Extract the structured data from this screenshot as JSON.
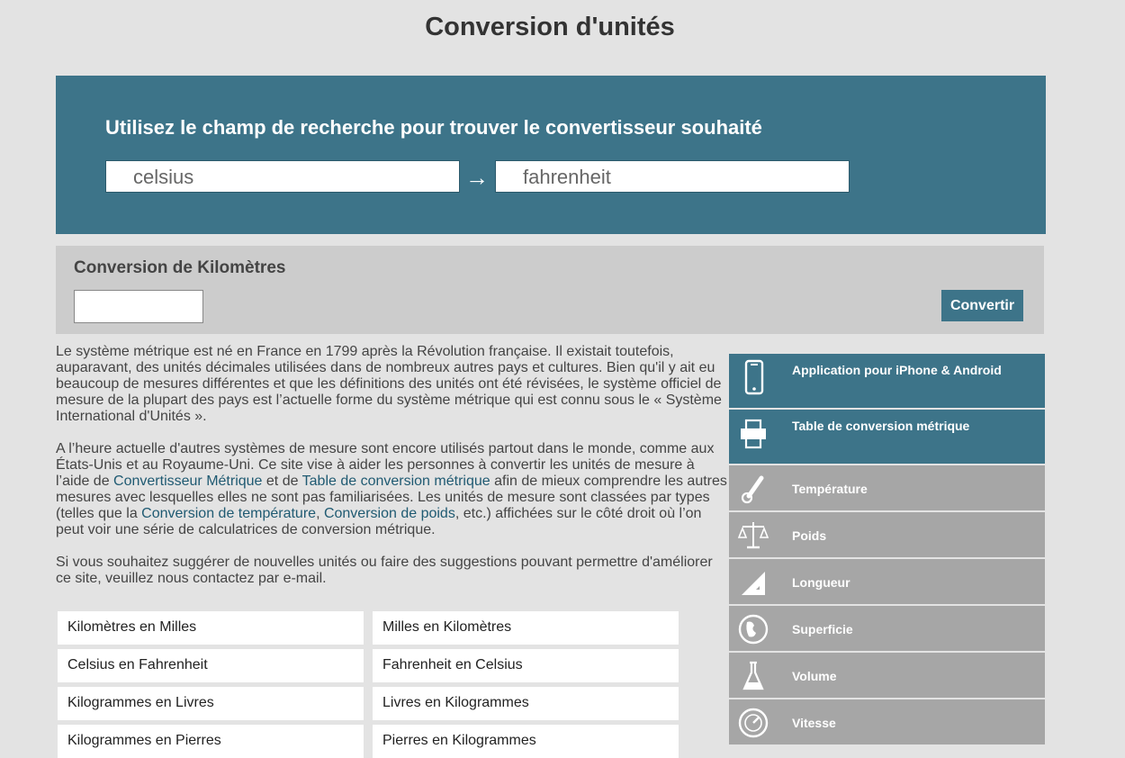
{
  "page": {
    "title": "Conversion d'unités"
  },
  "search": {
    "heading": "Utilisez le champ de recherche pour trouver le convertisseur souhaité",
    "from_value": "celsius",
    "to_value": "fahrenheit",
    "arrow": "→"
  },
  "converter": {
    "title": "Conversion de Kilomètres",
    "input_value": "",
    "button_label": "Convertir"
  },
  "content": {
    "p1": "Le système métrique est né en France en 1799 après la Révolution française. Il existait toutefois, auparavant, des unités décimales utilisées dans de nombreux autres pays et cultures. Bien qu'il y ait eu beaucoup de mesures différentes et que les définitions des unités ont été révisées, le système officiel de mesure de la plupart des pays est l’actuelle forme du système métrique qui est connu sous le « Système International d'Unités ».",
    "p2_a": "A l’heure actuelle d'autres systèmes de mesure sont encore utilisés partout dans le monde, comme aux États-Unis et au Royaume-Uni. Ce site vise à aider les personnes à convertir les unités de mesure à l’aide de ",
    "p2_link1": "Convertisseur Métrique",
    "p2_b": " et de ",
    "p2_link2": "Table de conversion métrique",
    "p2_c": " afin de mieux comprendre les autres mesures avec lesquelles elles ne sont pas familiarisées. Les unités de mesure sont classées par types (telles que la ",
    "p2_link3": "Conversion de température",
    "p2_d": ", ",
    "p2_link4": "Conversion de poids",
    "p2_e": ", etc.) affichées sur le côté droit où l’on peut voir une série de calculatrices de conversion métrique.",
    "p3": "Si vous souhaitez suggérer de nouvelles unités ou faire des suggestions pouvant permettre d'améliorer ce site, veuillez nous contactez par e-mail."
  },
  "links": [
    "Kilomètres en Milles",
    "Milles en Kilomètres",
    "Celsius en Fahrenheit",
    "Fahrenheit en Celsius",
    "Kilogrammes en Livres",
    "Livres en Kilogrammes",
    "Kilogrammes en Pierres",
    "Pierres en Kilogrammes"
  ],
  "sidebar": {
    "items": [
      {
        "label": "Application pour iPhone & Android",
        "icon": "phone-icon"
      },
      {
        "label": "Table de conversion métrique",
        "icon": "printer-icon"
      },
      {
        "label": "Température",
        "icon": "thermometer-icon"
      },
      {
        "label": "Poids",
        "icon": "scale-icon"
      },
      {
        "label": "Longueur",
        "icon": "ruler-icon"
      },
      {
        "label": "Superficie",
        "icon": "globe-icon"
      },
      {
        "label": "Volume",
        "icon": "flask-icon"
      },
      {
        "label": "Vitesse",
        "icon": "speedometer-icon"
      }
    ]
  },
  "colors": {
    "accent": "#3d7489",
    "background": "#e3e3e3",
    "sidebar_grey": "#a6a6a6"
  }
}
